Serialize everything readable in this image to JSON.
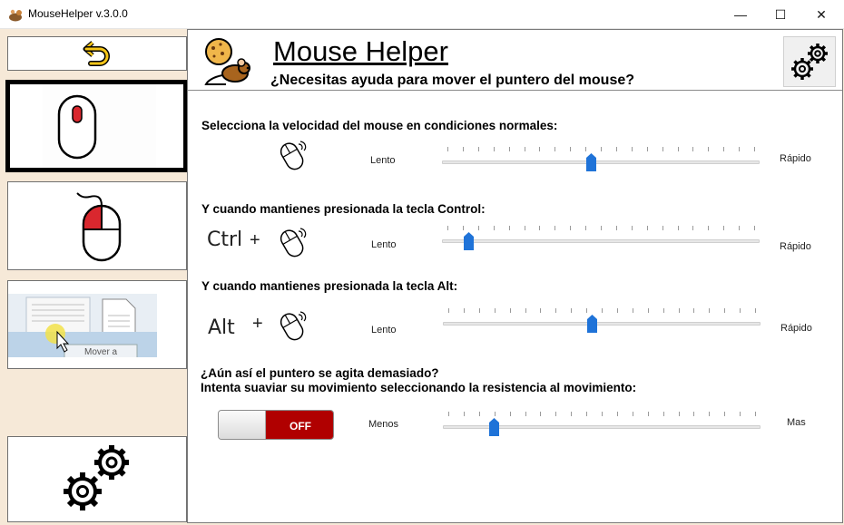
{
  "window": {
    "title": "MouseHelper v.3.0.0",
    "minimize_glyph": "—",
    "maximize_glyph": "☐",
    "close_glyph": "✕"
  },
  "sidebar": {
    "items": [
      {
        "name": "back",
        "icon": "undo-arrow-icon"
      },
      {
        "name": "normal-mode",
        "icon": "mouse-icon",
        "selected": true
      },
      {
        "name": "drag-mode",
        "icon": "mouse-left-click-icon"
      },
      {
        "name": "move-mode",
        "icon": "move-preview-image",
        "image_text": "Mover a"
      },
      {
        "name": "settings",
        "icon": "gears-icon"
      }
    ]
  },
  "header": {
    "title": "Mouse Helper",
    "subtitle": "¿Necesitas ayuda para mover el puntero del mouse?",
    "settings_icon": "gears-icon"
  },
  "sections": {
    "normal": {
      "label": "Selecciona la velocidad del mouse en condiciones normales:",
      "min_label": "Lento",
      "max_label": "Rápido",
      "value": 0.47
    },
    "control": {
      "label": "Y cuando mantienes presionada la tecla Control:",
      "key": "Ctrl",
      "plus": "+",
      "min_label": "Lento",
      "max_label": "Rápido",
      "value": 0.07
    },
    "alt": {
      "label": "Y cuando mantienes presionada la tecla Alt:",
      "key": "Alt",
      "plus": "+",
      "min_label": "Lento",
      "max_label": "Rápido",
      "value": 0.47
    },
    "smoothing": {
      "label_line1": "¿Aún así el puntero se agita demasiado?",
      "label_line2": "Intenta suaviar su movimiento seleccionando la resistencia al movimiento:",
      "toggle_label": "OFF",
      "toggle_state": "off",
      "min_label": "Menos",
      "max_label": "Mas",
      "value": 0.15
    }
  },
  "colors": {
    "sidebar_bg": "#f6e9d8",
    "accent_blue": "#1f73d8",
    "toggle_off": "#b00000",
    "mouse_red": "#d9272e"
  }
}
